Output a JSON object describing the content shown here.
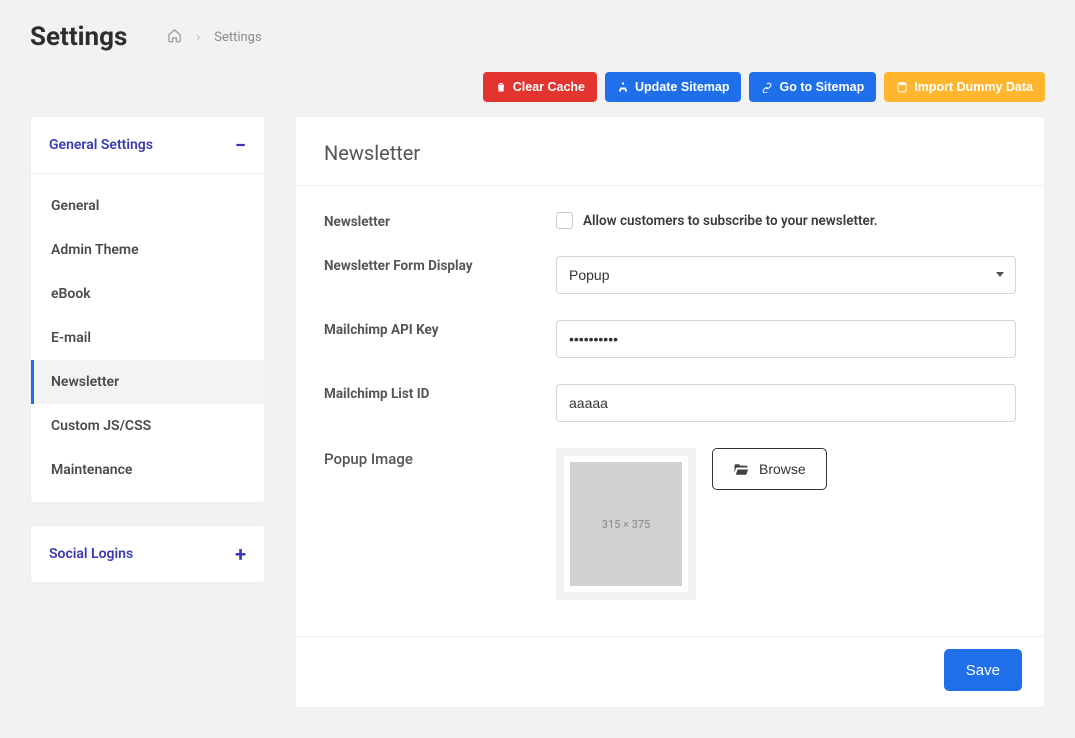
{
  "page": {
    "title": "Settings",
    "breadcrumb_current": "Settings"
  },
  "toolbar": {
    "clear_cache": "Clear Cache",
    "update_sitemap": "Update Sitemap",
    "go_to_sitemap": "Go to Sitemap",
    "import_dummy": "Import Dummy Data"
  },
  "sidebar": {
    "group1": {
      "title": "General Settings",
      "items": [
        {
          "label": "General"
        },
        {
          "label": "Admin Theme"
        },
        {
          "label": "eBook"
        },
        {
          "label": "E-mail"
        },
        {
          "label": "Newsletter"
        },
        {
          "label": "Custom JS/CSS"
        },
        {
          "label": "Maintenance"
        }
      ]
    },
    "group2": {
      "title": "Social Logins"
    }
  },
  "main": {
    "section_title": "Newsletter",
    "fields": {
      "newsletter_label": "Newsletter",
      "newsletter_check_label": "Allow customers to subscribe to your newsletter.",
      "form_display_label": "Newsletter Form Display",
      "form_display_value": "Popup",
      "api_key_label": "Mailchimp API Key",
      "api_key_value": "••••••••••",
      "list_id_label": "Mailchimp List ID",
      "list_id_value": "aaaaa",
      "popup_image_label": "Popup Image",
      "popup_image_dim": "315 × 375",
      "browse_label": "Browse"
    },
    "save_label": "Save"
  }
}
